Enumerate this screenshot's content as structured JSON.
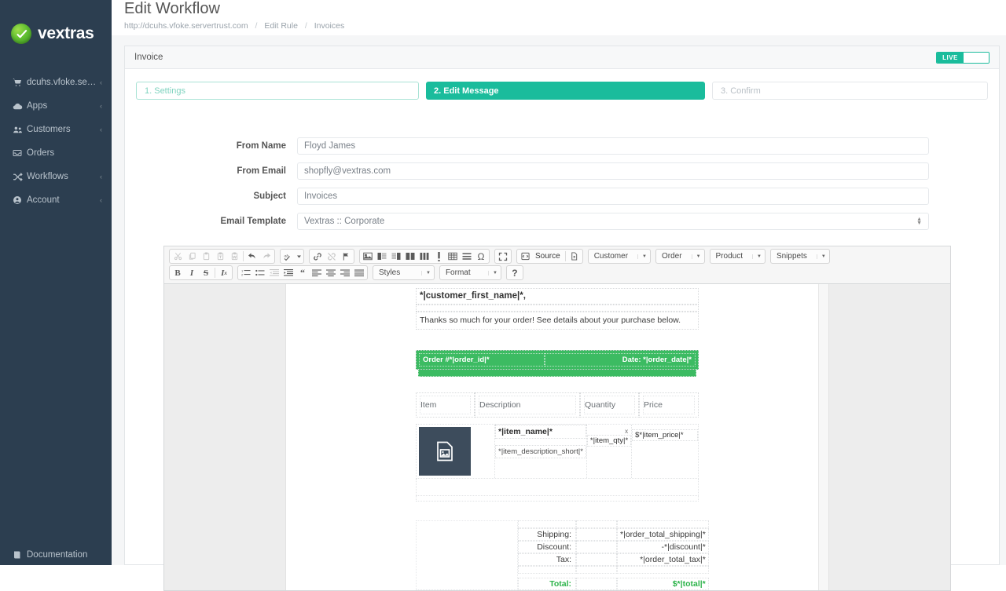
{
  "sidebar": {
    "brand": {
      "name": "vextras",
      "logo_icon": "check-circle-logo"
    },
    "items": [
      {
        "label": "dcuhs.vfoke.ser...",
        "icon": "cart-icon",
        "caret": "‹"
      },
      {
        "label": "Apps",
        "icon": "cloud-icon",
        "caret": "‹"
      },
      {
        "label": "Customers",
        "icon": "users-icon",
        "caret": "‹"
      },
      {
        "label": "Orders",
        "icon": "inbox-icon",
        "caret": ""
      },
      {
        "label": "Workflows",
        "icon": "shuffle-icon",
        "caret": "‹"
      },
      {
        "label": "Account",
        "icon": "user-circle-icon",
        "caret": "‹"
      }
    ],
    "bottom_item": {
      "label": "Documentation",
      "icon": "book-icon"
    }
  },
  "header": {
    "title": "Edit Workflow",
    "breadcrumb": [
      "http://dcuhs.vfoke.servertrust.com",
      "Edit Rule",
      "Invoices"
    ],
    "breadcrumb_separator": "/"
  },
  "panel": {
    "title": "Invoice",
    "toggle": {
      "label": "LIVE",
      "state": "on",
      "color": "#1abc9c"
    }
  },
  "steps": [
    {
      "label": "1. Settings",
      "state": "idle"
    },
    {
      "label": "2. Edit Message",
      "state": "active"
    },
    {
      "label": "3. Confirm",
      "state": "idle"
    }
  ],
  "form": {
    "fields": [
      {
        "label": "From Name",
        "value": "Floyd James",
        "type": "text"
      },
      {
        "label": "From Email",
        "value": "shopfly@vextras.com",
        "type": "text"
      },
      {
        "label": "Subject",
        "value": "Invoices",
        "type": "text"
      },
      {
        "label": "Email Template",
        "value": "Vextras :: Corporate",
        "type": "select"
      }
    ]
  },
  "editor": {
    "toolbar_row1": {
      "group1": [
        "cut-icon",
        "copy-icon",
        "paste-icon",
        "paste-text-icon",
        "paste-word-icon",
        "undo-icon",
        "redo-icon"
      ],
      "group2": [
        "spellcheck-icon"
      ],
      "group3": [
        "link-icon",
        "unlink-icon",
        "anchor-icon"
      ],
      "group4": [
        "image-icon",
        "template-left-icon",
        "template-right-icon",
        "columns-2-icon",
        "columns-3-icon",
        "divider-icon",
        "table-icon",
        "horizontal-rule-icon",
        "special-char-icon"
      ],
      "group5": [
        "maximize-icon"
      ],
      "source_label": "Source",
      "source_icon": "source-icon",
      "preview_icon": "preview-icon",
      "dropdowns": [
        "Customer",
        "Order",
        "Product",
        "Snippets"
      ]
    },
    "toolbar_row2": {
      "group1": [
        "bold-icon",
        "italic-icon",
        "strikethrough-icon",
        "remove-format-icon"
      ],
      "group2": [
        "numbered-list-icon",
        "bulleted-list-icon",
        "outdent-icon",
        "indent-icon",
        "blockquote-icon",
        "align-left-icon",
        "align-center-icon",
        "align-right-icon",
        "align-justify-icon"
      ],
      "styles_label": "Styles",
      "format_label": "Format",
      "help_label": "?"
    }
  },
  "message": {
    "greeting": "*|customer_first_name|*,",
    "intro": "Thanks so much for your order! See details about your purchase below.",
    "order_bar": {
      "order": "Order #*|order_id|*",
      "date": "Date: *|order_date|*",
      "bg_color": "#3cbb62"
    },
    "table_headers": [
      "Item",
      "Description",
      "Quantity",
      "Price"
    ],
    "product": {
      "image_icon": "image-placeholder-icon",
      "name": "*|item_name|*",
      "description": "*|item_description_short|*",
      "qty_x": "x",
      "qty": "*|item_qty|*",
      "price": "$*|item_price|*"
    },
    "totals": [
      {
        "label": "Shipping:",
        "value": "*|order_total_shipping|*"
      },
      {
        "label": "Discount:",
        "value": "-*|discount|*"
      },
      {
        "label": "Tax:",
        "value": "*|order_total_tax|*"
      }
    ],
    "grand_total": {
      "label": "Total:",
      "value": "$*|total|*",
      "color": "#2cb34a"
    }
  }
}
